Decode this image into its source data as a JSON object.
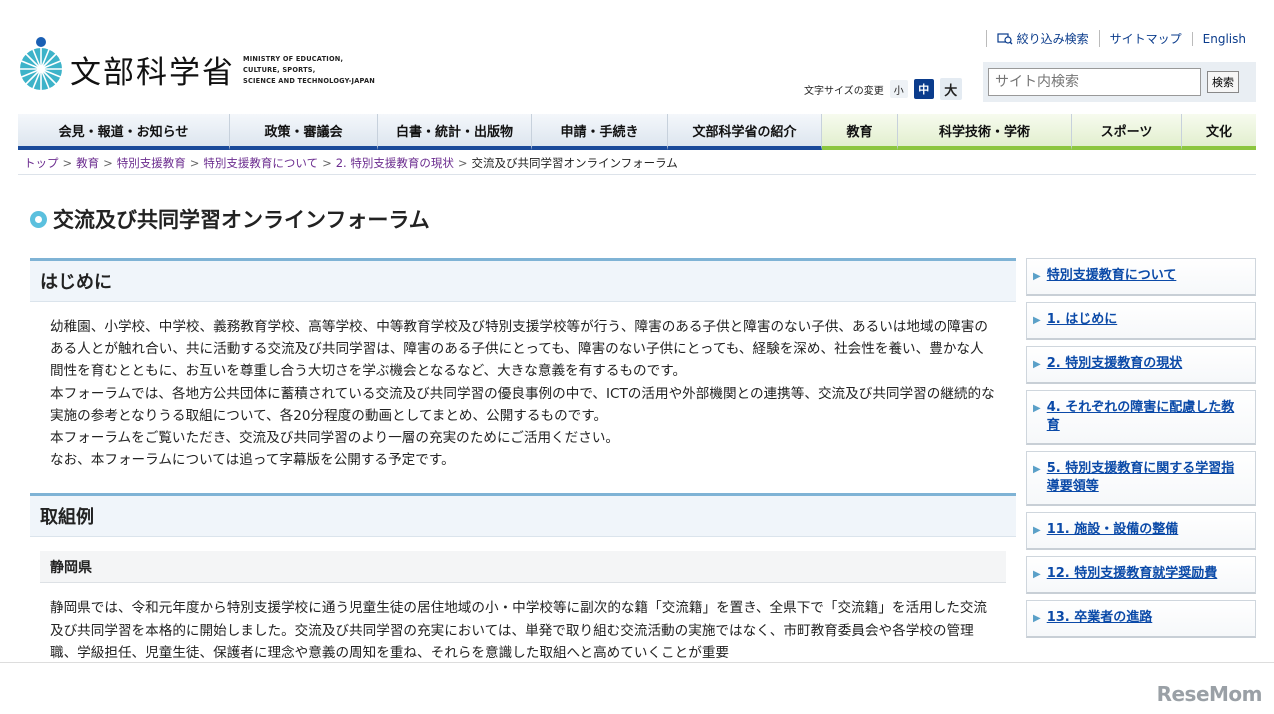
{
  "header": {
    "logo_jp": "文部科学省",
    "logo_en_1": "MINISTRY OF EDUCATION,",
    "logo_en_2": "CULTURE, SPORTS,",
    "logo_en_3": "SCIENCE AND TECHNOLOGY-JAPAN",
    "util_links": [
      "絞り込み検索",
      "サイトマップ",
      "English"
    ],
    "fontsize_label": "文字サイズの変更",
    "fontsize_small": "小",
    "fontsize_mid": "中",
    "fontsize_large": "大",
    "search_placeholder": "サイト内検索",
    "search_button": "検索"
  },
  "gnav": [
    {
      "label": "会見・報道・お知らせ"
    },
    {
      "label": "政策・審議会"
    },
    {
      "label": "白書・統計・出版物"
    },
    {
      "label": "申請・手続き"
    },
    {
      "label": "文部科学省の紹介"
    },
    {
      "label": "教育"
    },
    {
      "label": "科学技術・学術"
    },
    {
      "label": "スポーツ"
    },
    {
      "label": "文化"
    }
  ],
  "breadcrumb": [
    "トップ",
    "教育",
    "特別支援教育",
    "特別支援教育について",
    "2. 特別支援教育の現状",
    "交流及び共同学習オンラインフォーラム"
  ],
  "page_title": "交流及び共同学習オンラインフォーラム",
  "sections": {
    "intro_heading": "はじめに",
    "intro_p1": "幼稚園、小学校、中学校、義務教育学校、高等学校、中等教育学校及び特別支援学校等が行う、障害のある子供と障害のない子供、あるいは地域の障害のある人とが触れ合い、共に活動する交流及び共同学習は、障害のある子供にとっても、障害のない子供にとっても、経験を深め、社会性を養い、豊かな人間性を育むとともに、お互いを尊重し合う大切さを学ぶ機会となるなど、大きな意義を有するものです。",
    "intro_p2": "本フォーラムでは、各地方公共団体に蓄積されている交流及び共同学習の優良事例の中で、ICTの活用や外部機関との連携等、交流及び共同学習の継続的な実施の参考となりうる取組について、各20分程度の動画としてまとめ、公開するものです。",
    "intro_p3": "本フォーラムをご覧いただき、交流及び共同学習のより一層の充実のためにご活用ください。",
    "intro_p4": "なお、本フォーラムについては追って字幕版を公開する予定です。",
    "examples_heading": "取組例",
    "shizuoka_heading": "静岡県",
    "shizuoka_p": "静岡県では、令和元年度から特別支援学校に通う児童生徒の居住地域の小・中学校等に副次的な籍「交流籍」を置き、全県下で「交流籍」を活用した交流及び共同学習を本格的に開始しました。交流及び共同学習の充実においては、単発で取り組む交流活動の実施ではなく、市町教育委員会や各学校の管理職、学級担任、児童生徒、保護者に理念や意義の周知を重ね、それらを意識した取組へと高めていくことが重要"
  },
  "side_nav": [
    "特別支援教育について",
    "1. はじめに",
    "2. 特別支援教育の現状",
    "4. それぞれの障害に配慮した教育",
    "5. 特別支援教育に関する学習指導要領等",
    "11. 施設・設備の整備",
    "12. 特別支援教育就学奨励費",
    "13. 卒業者の進路"
  ],
  "watermark": "ReseMom",
  "colors": {
    "nav_blue": "#1a4a9a",
    "nav_green": "#8cc63f",
    "link_blue": "#0b4aa8",
    "breadcrumb_link": "#6b2c8f",
    "accent_cyan": "#5bc0de"
  }
}
